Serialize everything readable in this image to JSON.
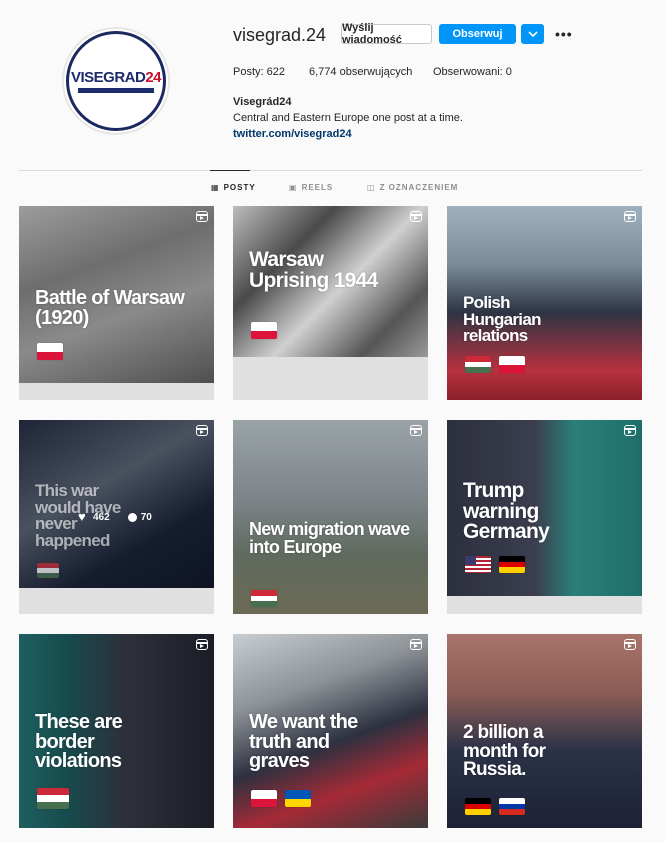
{
  "profile": {
    "username": "visegrad.24",
    "logo_text_main": "VISEGRAD",
    "logo_text_num": "24",
    "send_message_label": "Wyślij wiadomość",
    "follow_label": "Obserwuj",
    "chevron_icon": "chevron-down-icon",
    "more_icon": "more-options-icon",
    "stats": {
      "posts": "Posty: 622",
      "followers": "6,774 obserwujących",
      "following": "Obserwowani: 0"
    },
    "bio_name": "Visegrád24",
    "bio_text": "Central and Eastern Europe one post at a time.",
    "bio_link": "twitter.com/visegrad24"
  },
  "tabs": [
    {
      "label": "POSTY",
      "icon": "grid-icon",
      "active": true
    },
    {
      "label": "REELS",
      "icon": "reels-icon",
      "active": false
    },
    {
      "label": "Z OZNACZENIEM",
      "icon": "tagged-icon",
      "active": false
    }
  ],
  "posts": [
    {
      "caption": "Battle of Warsaw (1920)",
      "flags": [
        "poland"
      ],
      "type": "reel"
    },
    {
      "caption": "Warsaw Uprising 1944",
      "flags": [
        "poland"
      ],
      "type": "reel"
    },
    {
      "caption": "Polish Hungarian relations",
      "flags": [
        "hungary",
        "poland"
      ],
      "type": "reel"
    },
    {
      "caption": "This war would have never happened",
      "flags": [
        "hungary"
      ],
      "type": "reel",
      "hover": {
        "likes": "462",
        "comments": "70"
      }
    },
    {
      "caption": "New migration wave into Europe",
      "flags": [
        "hungary"
      ],
      "type": "reel"
    },
    {
      "caption": "Trump warning Germany",
      "flags": [
        "usa",
        "germany"
      ],
      "type": "reel"
    },
    {
      "caption": "These are border violations",
      "flags": [
        "hungary"
      ],
      "type": "reel"
    },
    {
      "caption": "We want the truth and graves",
      "flags": [
        "poland",
        "ukraine"
      ],
      "type": "reel"
    },
    {
      "caption": "2 billion a month for Russia.",
      "flags": [
        "germany",
        "russia"
      ],
      "type": "reel"
    }
  ],
  "colors": {
    "accent": "#0095f6",
    "link": "#00376b",
    "background": "#fafafa"
  }
}
